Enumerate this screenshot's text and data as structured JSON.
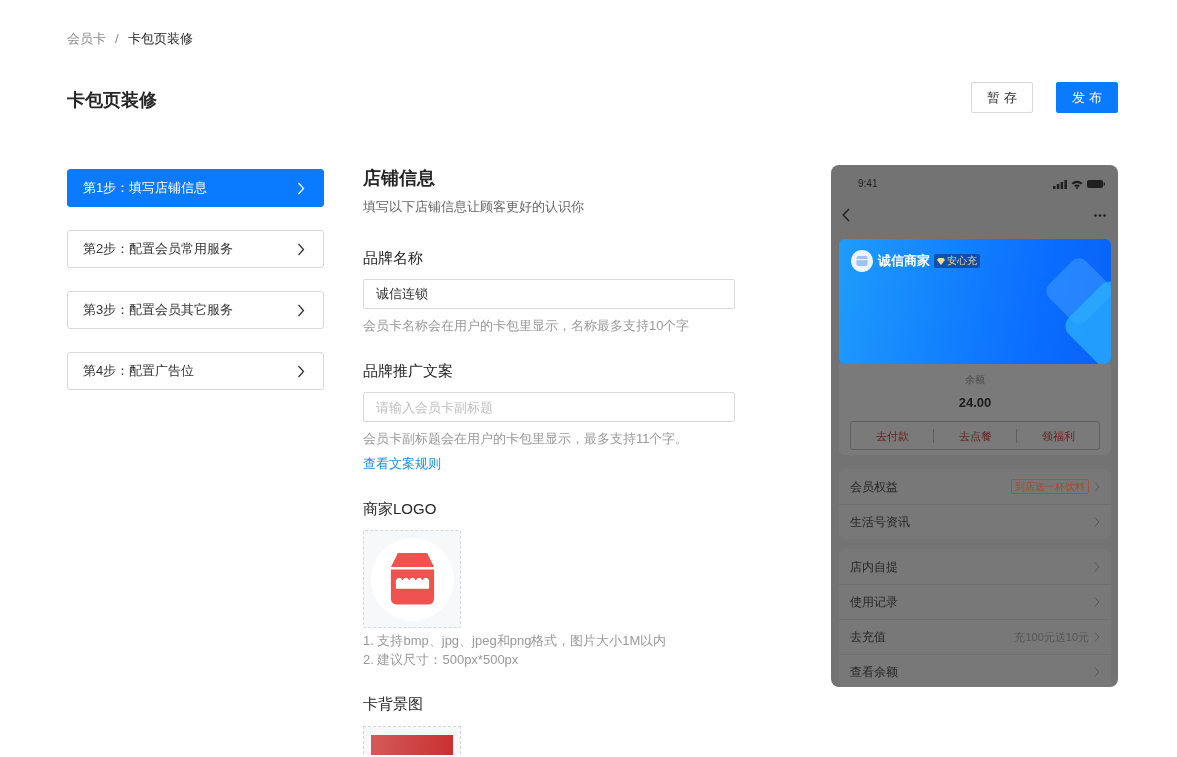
{
  "breadcrumb": {
    "separator": "/",
    "items": [
      {
        "label": "会员卡",
        "current": false
      },
      {
        "label": "卡包页装修",
        "current": true
      }
    ]
  },
  "page_title": "卡包页装修",
  "actions": [
    {
      "label": "暂存",
      "kind": "secondary"
    },
    {
      "label": "发布",
      "kind": "primary"
    }
  ],
  "steps": [
    {
      "label": "第1步：填写店铺信息",
      "selected": true
    },
    {
      "label": "第2步：配置会员常用服务",
      "selected": false
    },
    {
      "label": "第3步：配置会员其它服务",
      "selected": false
    },
    {
      "label": "第4步：配置广告位",
      "selected": false
    }
  ],
  "form": {
    "title": "店铺信息",
    "subtitle": "填写以下店铺信息让顾客更好的认识你",
    "fields": [
      {
        "kind": "text",
        "label": "品牌名称",
        "value": "诚信连锁",
        "help": "会员卡名称会在用户的卡包里显示，名称最多支持10个字"
      },
      {
        "kind": "text",
        "label": "品牌推广文案",
        "placeholder": "请输入会员卡副标题",
        "help": "会员卡副标题会在用户的卡包里显示，最多支持11个字。",
        "link": "查看文案规则"
      },
      {
        "kind": "logo_upload",
        "label": "商家LOGO",
        "notes": [
          "1. 支持bmp、jpg、jpeg和png格式，图片大小1M以内",
          "2. 建议尺寸：500px*500px"
        ]
      },
      {
        "kind": "image_upload",
        "label": "卡背景图"
      }
    ]
  },
  "preview": {
    "status_time": "9:41",
    "card": {
      "merchant": "诚信商家",
      "badge": "安心充"
    },
    "balance_label": "余额",
    "balance": "24.00",
    "card_actions": [
      "去付款",
      "去点餐",
      "领福利"
    ],
    "menu_groups": [
      {
        "items": [
          {
            "label": "会员权益",
            "tag": "到店送一杯饮料"
          },
          {
            "label": "生活号资讯"
          }
        ]
      },
      {
        "items": [
          {
            "label": "店内自提"
          },
          {
            "label": "使用记录"
          },
          {
            "label": "去充值",
            "note": "充100元送10元"
          },
          {
            "label": "查看余额"
          }
        ]
      }
    ]
  }
}
